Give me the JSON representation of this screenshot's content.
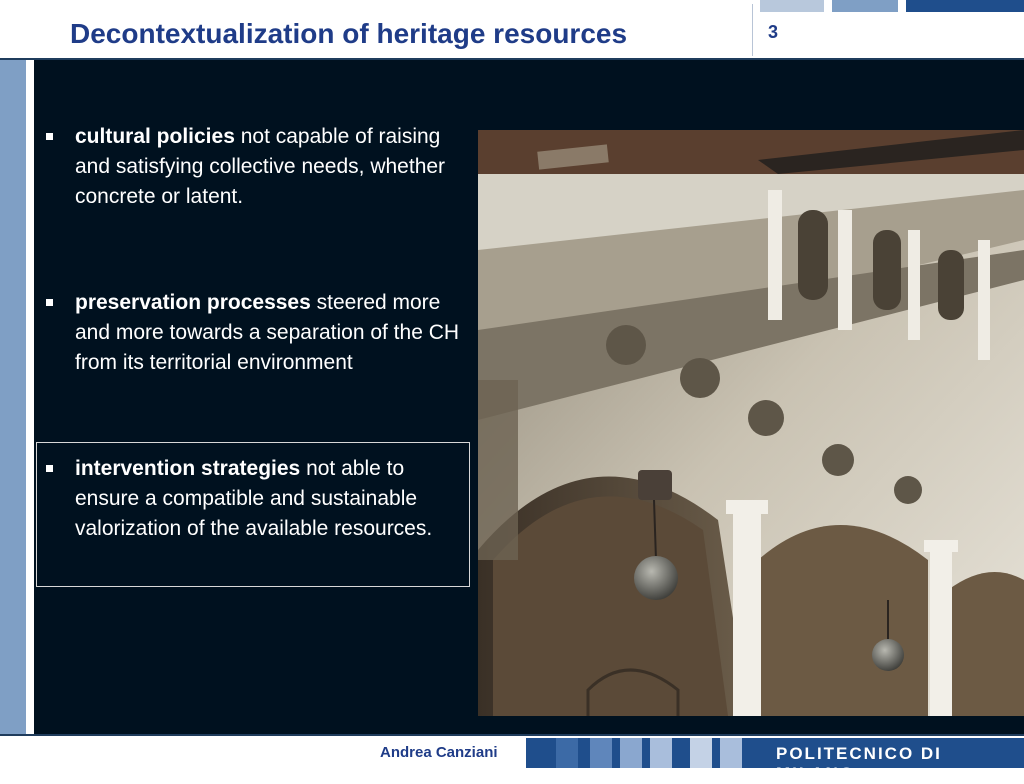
{
  "header": {
    "title": "Decontextualization of heritage resources",
    "slide_number": "3"
  },
  "bullets": [
    {
      "term": "cultural policies",
      "text": " not capable of raising and satisfying collective needs, whether concrete or latent."
    },
    {
      "term": "preservation processes",
      "text": " steered more and more towards a separation of the CH from its territorial environment"
    },
    {
      "term": "intervention strategies",
      "text": " not able to ensure a compatible and sustainable valorization of the available resources."
    }
  ],
  "footer": {
    "author": "Andrea Canziani",
    "institution": "POLITECNICO DI MILANO"
  },
  "colors": {
    "title": "#1f3c88",
    "panel": "#00111f",
    "accent": "#1f4e8c",
    "stripe": "#7f9fc5"
  }
}
